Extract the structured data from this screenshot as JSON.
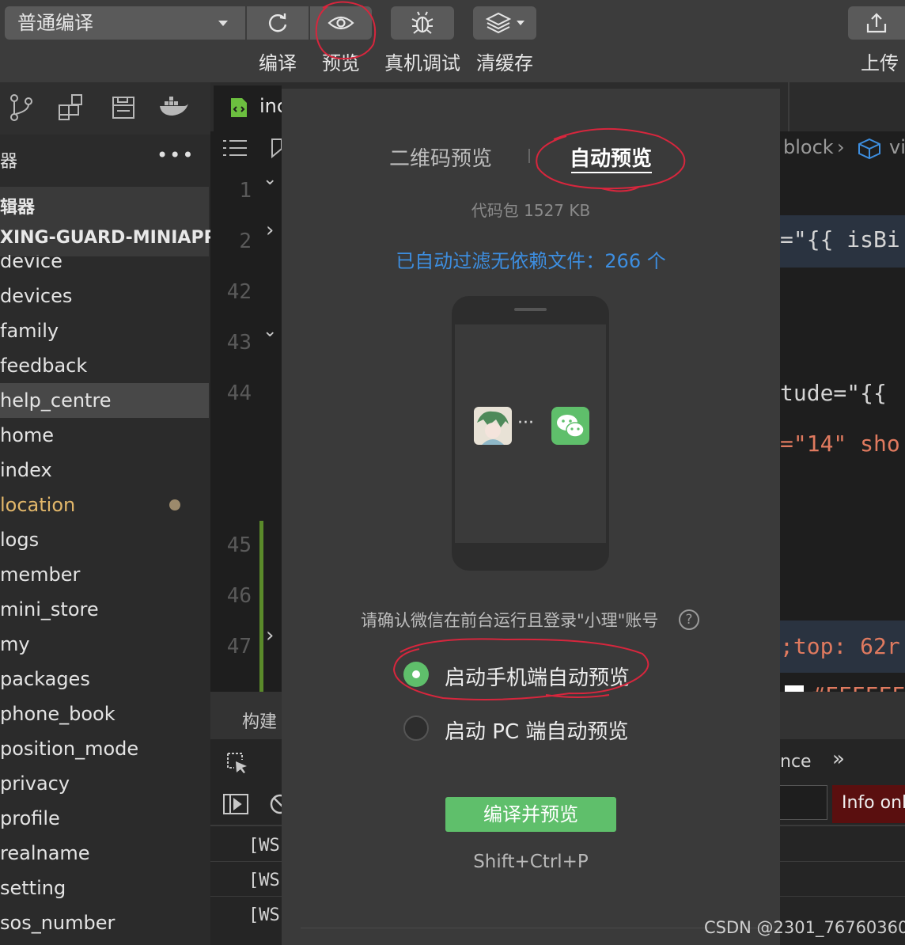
{
  "toolbar": {
    "mode_select": "普通编译",
    "buttons": [
      {
        "label": "编译",
        "icon": "refresh-icon"
      },
      {
        "label": "预览",
        "icon": "eye-icon"
      },
      {
        "label": "真机调试",
        "icon": "bug-icon"
      },
      {
        "label": "清缓存",
        "icon": "layers-icon"
      },
      {
        "label": "上传",
        "icon": "upload-icon"
      }
    ]
  },
  "sidebar": {
    "title": "器",
    "more": "•••",
    "section_label": "辑器",
    "project_name": "XING-GUARD-MINIAPP",
    "items": [
      "device",
      "devices",
      "family",
      "feedback",
      "help_centre",
      "home",
      "index",
      "location",
      "logs",
      "member",
      "mini_store",
      "my",
      "packages",
      "phone_book",
      "position_mode",
      "privacy",
      "profile",
      "realname",
      "setting",
      "sos_number"
    ]
  },
  "editor": {
    "tab_label": "inc",
    "breadcrumb": [
      "block",
      "vi"
    ],
    "line_numbers": [
      "1",
      "2",
      "42",
      "43",
      "44",
      "45",
      "46",
      "47"
    ],
    "code_lines": [
      "=\"{{ isBi",
      "tude=\"{{",
      "=\"14\" sho",
      ";top: 62r",
      "#FFFFFF"
    ]
  },
  "bottom_panel": {
    "tab_build": "构建",
    "tab_more": "nce",
    "filter_level": "Info onl",
    "log_lines": [
      "[WS]",
      "[WS]",
      "[WS]"
    ]
  },
  "preview_dialog": {
    "tabs": [
      {
        "label": "二维码预览",
        "active": false
      },
      {
        "label": "自动预览",
        "active": true
      }
    ],
    "package_size": "代码包 1527 KB",
    "filtered_files": "已自动过滤无依赖文件：266 个",
    "confirm_text": "请确认微信在前台运行且登录\"小理\"账号",
    "options": [
      {
        "label": "启动手机端自动预览",
        "selected": true
      },
      {
        "label": "启动 PC 端自动预览",
        "selected": false
      }
    ],
    "compile_button": "编译并预览",
    "shortcut": "Shift+Ctrl+P",
    "ellipsis": "···"
  },
  "watermark": "CSDN @2301_76760360",
  "colors": {
    "accent_green": "#5fbf6b",
    "link_blue": "#3d8ee0",
    "annotation_red": "#d7263d",
    "dialog_bg": "#3a3a3a"
  }
}
